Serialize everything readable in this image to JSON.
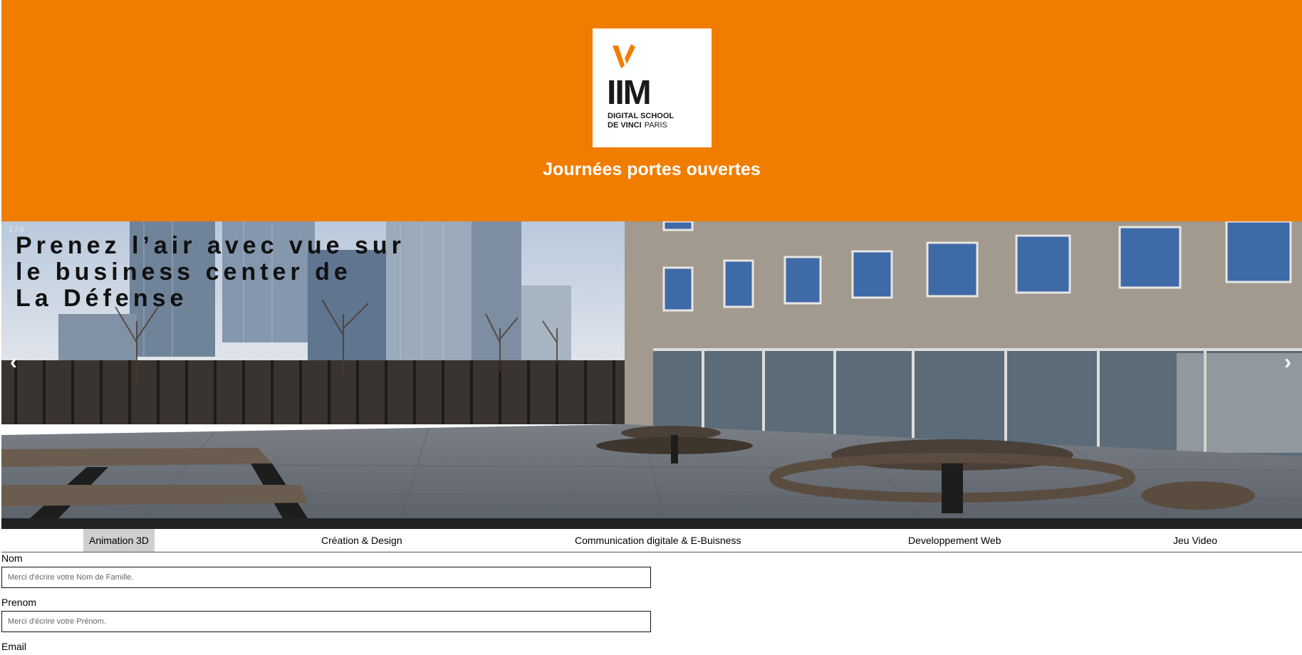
{
  "header": {
    "logo": {
      "wordmark": "IIM",
      "line1": "DIGITAL SCHOOL",
      "line2": "DE VINCI",
      "city": "PARIS"
    },
    "title": "Journées portes ouvertes",
    "colors": {
      "background": "#f07d00",
      "logo_accent": "#f07d00"
    }
  },
  "carousel": {
    "counter": "1 / 3",
    "caption": "Prenez l’air avec vue sur\nle business center de\nLa Défense",
    "prev_icon": "‹",
    "next_icon": "›"
  },
  "tabs": [
    {
      "label": "Animation 3D",
      "active": true
    },
    {
      "label": "Création & Design",
      "active": false
    },
    {
      "label": "Communication digitale & E-Buisness",
      "active": false
    },
    {
      "label": "Developpement Web",
      "active": false
    },
    {
      "label": "Jeu Video",
      "active": false
    }
  ],
  "form": {
    "nom": {
      "label": "Nom",
      "placeholder": "Merci d'écrire votre Nom de Famille."
    },
    "prenom": {
      "label": "Prenom",
      "placeholder": "Merci d'écrire votre Prénom."
    },
    "email": {
      "label": "Email"
    }
  }
}
